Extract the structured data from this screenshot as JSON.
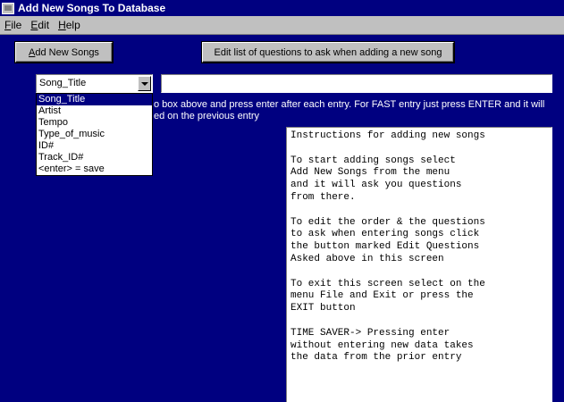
{
  "window": {
    "title": "Add New Songs To Database"
  },
  "menu": [
    {
      "label": "File",
      "accel": "F",
      "rest": "ile"
    },
    {
      "label": "Edit",
      "accel": "E",
      "rest": "dit"
    },
    {
      "label": "Help",
      "accel": "H",
      "rest": "elp"
    }
  ],
  "buttons": {
    "add_accel": "A",
    "add_rest": "dd New Songs",
    "edit_questions": "Edit list of questions to ask when adding a new song"
  },
  "combo": {
    "value": "Song_Title",
    "options": [
      "Song_Title",
      "Artist",
      "Tempo",
      "Type_of_music",
      "ID#",
      "Track_ID#",
      "<enter> = save"
    ],
    "selected_index": 0
  },
  "entry": {
    "value": ""
  },
  "hint": {
    "line1": "o box above and press enter after each entry.  For FAST entry just press ENTER and it will",
    "line2": "ed on the previous entry"
  },
  "instructions": [
    "Instructions for adding new songs",
    "",
    "To start adding songs select",
    "Add New Songs from the menu",
    "and it will ask you questions",
    "from there.",
    "",
    "To edit the order & the questions",
    "to ask when entering songs click",
    "the button marked Edit Questions",
    "Asked above in this screen",
    "",
    "To exit this screen select on the",
    "menu File and Exit or press the",
    "EXIT button",
    "",
    "TIME SAVER-> Pressing enter",
    "without entering new data takes",
    "the data from the prior entry"
  ]
}
